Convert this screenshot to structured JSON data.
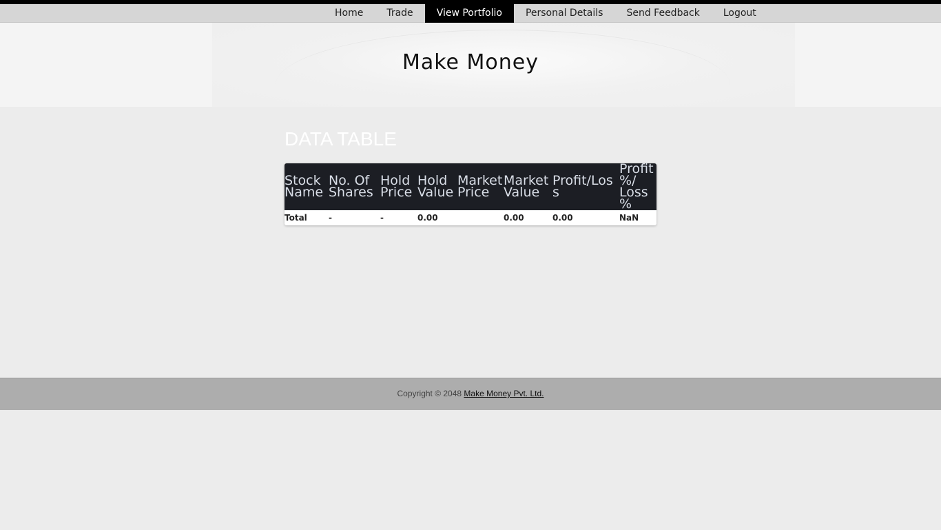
{
  "nav": {
    "items": [
      {
        "label": "Home"
      },
      {
        "label": "Trade"
      },
      {
        "label": "View Portfolio",
        "active": true
      },
      {
        "label": "Personal Details"
      },
      {
        "label": "Send Feedback"
      },
      {
        "label": "Logout"
      }
    ]
  },
  "header": {
    "site_title": "Make Money"
  },
  "main": {
    "heading": "DATA TABLE",
    "table": {
      "columns": [
        "Stock Name",
        "No. Of Shares",
        "Hold Price",
        "Hold Value",
        "Market Price",
        "Market Value",
        "Profit/Loss",
        "Profit %/ Loss %"
      ],
      "total_row": [
        "Total",
        "-",
        "-",
        "0.00",
        "",
        "0.00",
        "0.00",
        "NaN"
      ]
    }
  },
  "footer": {
    "copyright_prefix": "Copyright © 2048 ",
    "company_link": "Make Money Pvt. Ltd."
  },
  "colors": {
    "header_row_bg": "#1c1e24",
    "active_nav_bg": "#000000",
    "footer_bg": "#adadad",
    "page_bg": "#ececec"
  }
}
